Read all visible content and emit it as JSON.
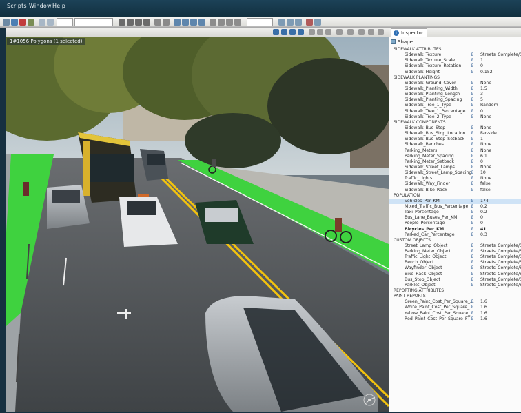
{
  "menu": [
    "Scripts",
    "Window",
    "Help"
  ],
  "viewport": {
    "label": "1#1056 Polygons (1 selected)"
  },
  "inspector": {
    "tab_label": "Inspector",
    "shape_label": "Shape",
    "rows": [
      {
        "label": "Sidewalk Attributes",
        "value": "",
        "type": "header"
      },
      {
        "label": "Sidewalk_Texture",
        "value": "Streets_Complete/S"
      },
      {
        "label": "Sidewalk_Texture_Scale",
        "value": "1"
      },
      {
        "label": "Sidewalk_Texture_Rotation",
        "value": "0"
      },
      {
        "label": "Sidewalk_Height",
        "value": "0.152"
      },
      {
        "label": "Sidewalk Plantings",
        "value": "",
        "type": "header"
      },
      {
        "label": "Sidewalk_Ground_Cover",
        "value": "None"
      },
      {
        "label": "Sidewalk_Planting_Width",
        "value": "1.5"
      },
      {
        "label": "Sidewalk_Planting_Length",
        "value": "3"
      },
      {
        "label": "Sidewalk_Planting_Spacing",
        "value": "5"
      },
      {
        "label": "Sidewalk_Tree_1_Type",
        "value": "Random"
      },
      {
        "label": "Sidewalk_Tree_1_Percentage",
        "value": "0"
      },
      {
        "label": "Sidewalk_Tree_2_Type",
        "value": "None"
      },
      {
        "label": "Sidewalk Components",
        "value": "",
        "type": "header"
      },
      {
        "label": "Sidewalk_Bus_Stop",
        "value": "None"
      },
      {
        "label": "Sidewalk_Bus_Stop_Location",
        "value": "Far-side"
      },
      {
        "label": "Sidewalk_Bus_Stop_Setback",
        "value": "1"
      },
      {
        "label": "Sidewalk_Benches",
        "value": "None"
      },
      {
        "label": "Parking_Meters",
        "value": "None"
      },
      {
        "label": "Parking_Meter_Spacing",
        "value": "6.1"
      },
      {
        "label": "Parking_Meter_Setback",
        "value": "0"
      },
      {
        "label": "Sidewalk_Street_Lamps",
        "value": "None"
      },
      {
        "label": "Sidewalk_Street_Lamp_Spacing",
        "value": "10"
      },
      {
        "label": "Traffic_Lights",
        "value": "None"
      },
      {
        "label": "Sidewalk_Way_Finder",
        "value": "false"
      },
      {
        "label": "Sidewalk_Bike_Rack",
        "value": "false"
      },
      {
        "label": "POPULATION",
        "value": "",
        "type": "header"
      },
      {
        "label": "Vehicles_Per_KM",
        "value": "174",
        "type": "selected"
      },
      {
        "label": "Mixed_Traffic_Bus_Percentage",
        "value": "0.2"
      },
      {
        "label": "Taxi_Percentage",
        "value": "0.2"
      },
      {
        "label": "Bus_Lane_Buses_Per_KM",
        "value": "0"
      },
      {
        "label": "People_Percentage",
        "value": "0"
      },
      {
        "label": "Bicycles_Per_KM",
        "value": "41",
        "type": "bold"
      },
      {
        "label": "Parked_Car_Percentage",
        "value": "0.3"
      },
      {
        "label": "CUSTOM OBJECTS",
        "value": "",
        "type": "header"
      },
      {
        "label": "Street_Lamp_Object",
        "value": "Streets_Complete/S"
      },
      {
        "label": "Parking_Meter_Object",
        "value": "Streets_Complete/S"
      },
      {
        "label": "Traffic_Light_Object",
        "value": "Streets_Complete/S"
      },
      {
        "label": "Bench_Object",
        "value": "Streets_Complete/S"
      },
      {
        "label": "Wayfinder_Object",
        "value": "Streets_Complete/S"
      },
      {
        "label": "Bike_Rack_Object",
        "value": "Streets_Complete/S"
      },
      {
        "label": "Bus_Stop_Object",
        "value": "Streets_Complete/S"
      },
      {
        "label": "Parklet_Object",
        "value": "Streets_Complete/S"
      },
      {
        "label": "REPORTING ATTRIBUTES",
        "value": "",
        "type": "header"
      },
      {
        "label": "Paint Reports",
        "value": "",
        "type": "header"
      },
      {
        "label": "Green_Paint_Cost_Per_Square_...",
        "value": "1.6"
      },
      {
        "label": "White_Paint_Cost_Per_Square_...",
        "value": "1.6"
      },
      {
        "label": "Yellow_Paint_Cost_Per_Square_...",
        "value": "1.6"
      },
      {
        "label": "Red_Paint_Cost_Per_Square_FT",
        "value": "1.6"
      }
    ]
  },
  "colors": {
    "menubar": "#163040",
    "bike_lane": "#3fd23f",
    "road": "#4f5356",
    "center_line": "#f2c20e",
    "selection": "#cfe3f6",
    "attr_marker": "#1c4f8a"
  }
}
